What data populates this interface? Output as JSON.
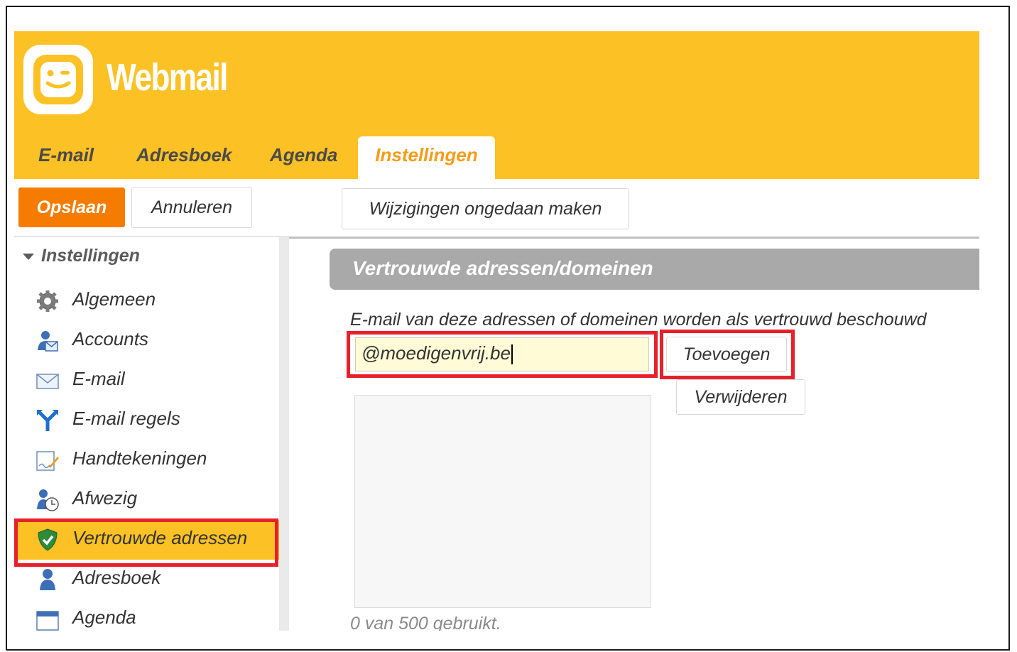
{
  "app": {
    "title": "Webmail"
  },
  "nav_tabs": [
    {
      "label": "E-mail"
    },
    {
      "label": "Adresboek"
    },
    {
      "label": "Agenda"
    },
    {
      "label": "Instellingen",
      "active": true
    }
  ],
  "toolbar": {
    "save_label": "Opslaan",
    "cancel_label": "Annuleren",
    "undo_label": "Wijzigingen ongedaan maken"
  },
  "sidebar": {
    "header": "Instellingen",
    "items": [
      {
        "label": "Algemeen",
        "icon": "gear-icon"
      },
      {
        "label": "Accounts",
        "icon": "accounts-icon"
      },
      {
        "label": "E-mail",
        "icon": "envelope-icon"
      },
      {
        "label": "E-mail regels",
        "icon": "mail-rules-icon"
      },
      {
        "label": "Handtekeningen",
        "icon": "signature-icon"
      },
      {
        "label": "Afwezig",
        "icon": "away-icon"
      },
      {
        "label": "Vertrouwde adressen",
        "icon": "shield-icon",
        "selected": true
      },
      {
        "label": "Adresboek",
        "icon": "contact-icon"
      },
      {
        "label": "Agenda",
        "icon": "calendar-icon"
      }
    ]
  },
  "main": {
    "section_title": "Vertrouwde adressen/domeinen",
    "description": "E-mail van deze adressen of domeinen worden als vertrouwd beschouwd",
    "address_input_value": "@moedigenvrij.be",
    "add_label": "Toevoegen",
    "remove_label": "Verwijderen",
    "usage_text": "0 van 500 gebruikt."
  },
  "colors": {
    "brand": "#fcc124",
    "accent": "#f57c00",
    "active_tab_text": "#f59c1a",
    "highlight": "#e8202a"
  }
}
